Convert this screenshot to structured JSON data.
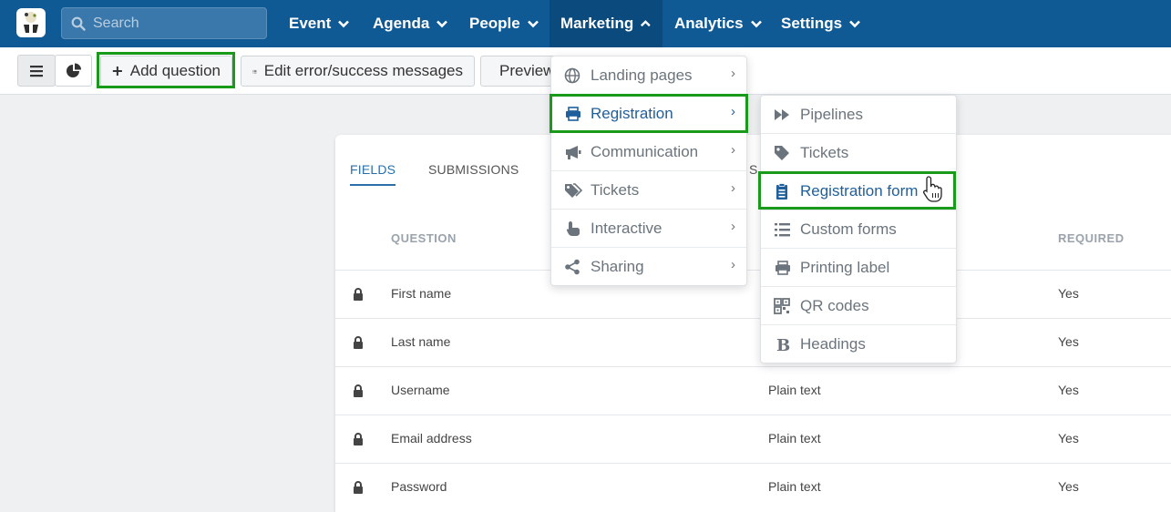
{
  "search": {
    "placeholder": "Search"
  },
  "nav": {
    "items": [
      {
        "label": "Event"
      },
      {
        "label": "Agenda"
      },
      {
        "label": "People"
      },
      {
        "label": "Marketing"
      },
      {
        "label": "Analytics"
      },
      {
        "label": "Settings"
      }
    ]
  },
  "toolbar": {
    "add_question": "Add question",
    "edit_messages": "Edit error/success messages",
    "preview": "Preview"
  },
  "tabs": [
    {
      "label": "FIELDS"
    },
    {
      "label": "SUBMISSIONS"
    },
    {
      "label": "S"
    }
  ],
  "table": {
    "headers": {
      "question": "QUESTION",
      "required": "REQUIRED"
    },
    "rows": [
      {
        "question": "First name",
        "type": "",
        "required": "Yes"
      },
      {
        "question": "Last name",
        "type": "",
        "required": "Yes"
      },
      {
        "question": "Username",
        "type": "Plain text",
        "required": "Yes"
      },
      {
        "question": "Email address",
        "type": "Plain text",
        "required": "Yes"
      },
      {
        "question": "Password",
        "type": "Plain text",
        "required": "Yes"
      }
    ]
  },
  "marketing_menu": [
    {
      "label": "Landing pages",
      "icon": "globe-icon"
    },
    {
      "label": "Registration",
      "icon": "printer-icon"
    },
    {
      "label": "Communication",
      "icon": "megaphone-icon"
    },
    {
      "label": "Tickets",
      "icon": "tags-icon"
    },
    {
      "label": "Interactive",
      "icon": "pointer-hand-icon"
    },
    {
      "label": "Sharing",
      "icon": "share-icon"
    }
  ],
  "registration_menu": [
    {
      "label": "Pipelines",
      "icon": "fast-forward-icon"
    },
    {
      "label": "Tickets",
      "icon": "tag-icon"
    },
    {
      "label": "Registration form",
      "icon": "clipboard-icon"
    },
    {
      "label": "Custom forms",
      "icon": "list-icon"
    },
    {
      "label": "Printing label",
      "icon": "printer-icon"
    },
    {
      "label": "QR codes",
      "icon": "qrcode-icon"
    },
    {
      "label": "Headings",
      "icon": "bold-icon"
    }
  ],
  "colors": {
    "nav_bg": "#0f5a95",
    "highlight": "#1a9a1a",
    "selected_text": "#1e5f9c"
  }
}
